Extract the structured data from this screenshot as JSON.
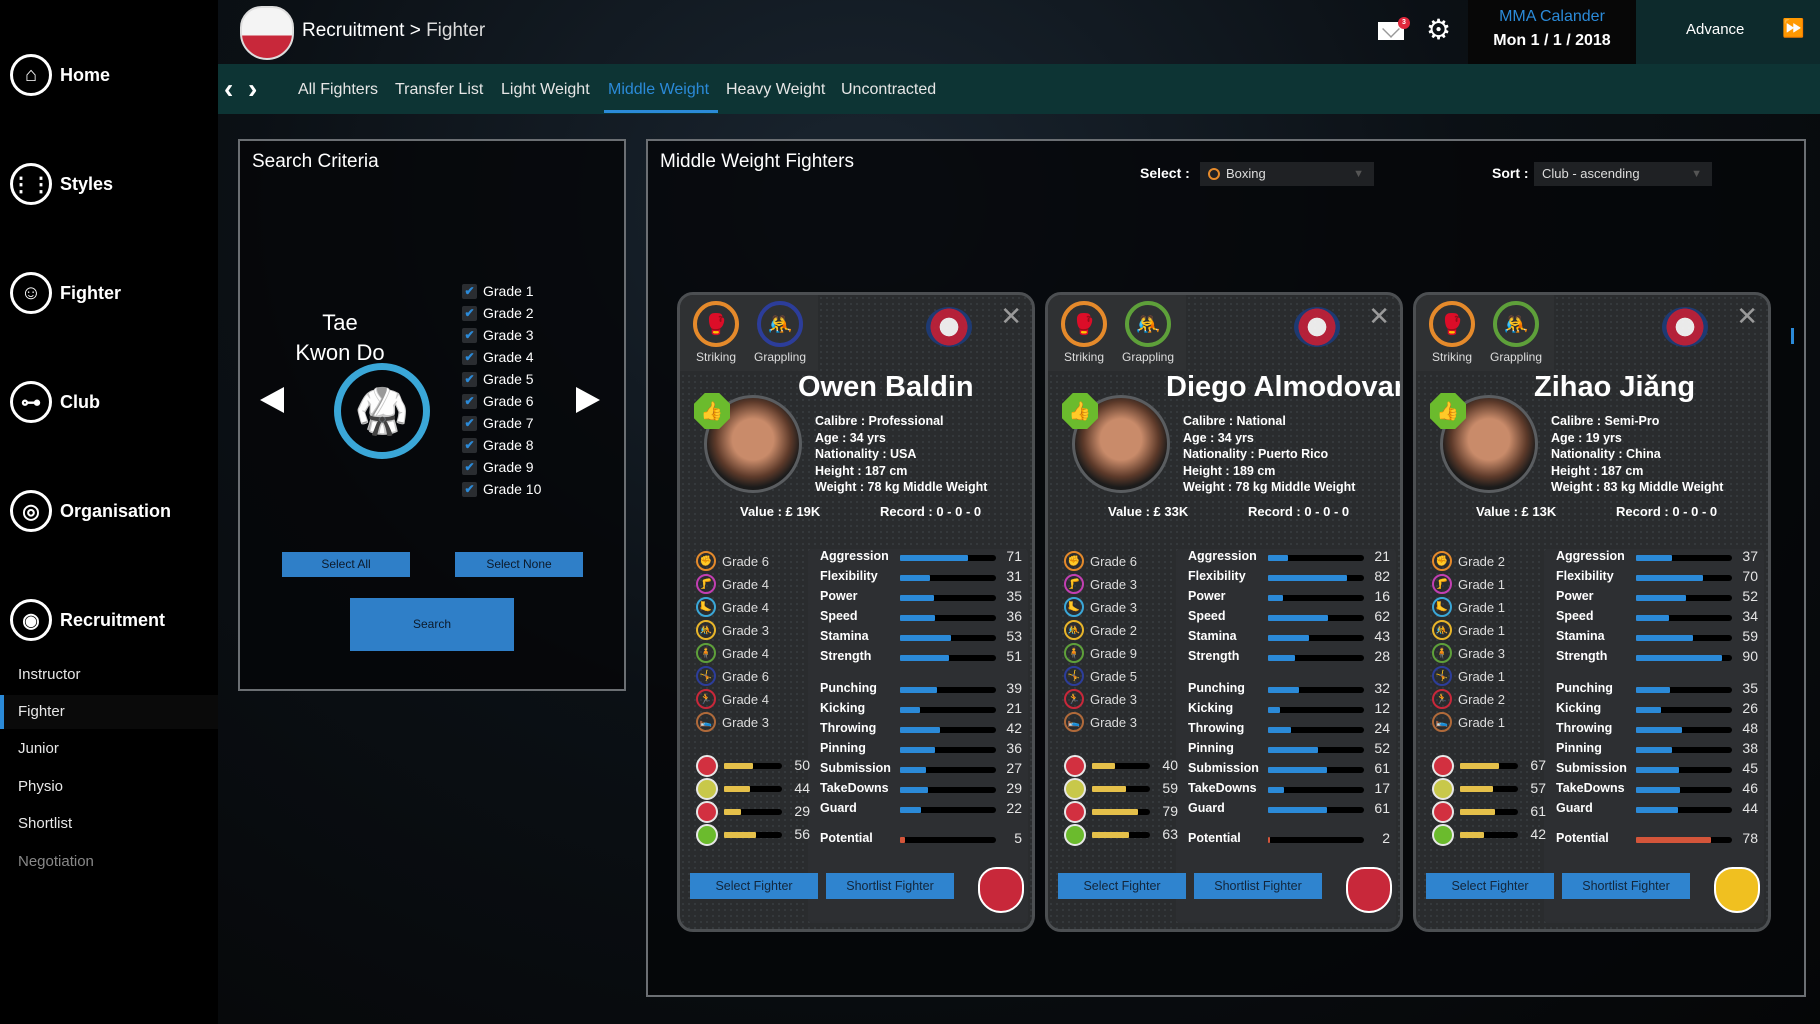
{
  "header": {
    "breadcrumb_parent": "Recruitment",
    "breadcrumb_sep": " > ",
    "breadcrumb_current": "Fighter",
    "mail_badge": "3",
    "calendar_title": "MMA Calander",
    "calendar_date": "Mon 1 / 1 / 2018",
    "advance_label": "Advance",
    "advance_icon": "⏩"
  },
  "sidebar": {
    "items": [
      {
        "label": "Home",
        "icon": "⌂"
      },
      {
        "label": "Styles",
        "icon": "⋮⋮"
      },
      {
        "label": "Fighter",
        "icon": "☺"
      },
      {
        "label": "Club",
        "icon": "⊶"
      },
      {
        "label": "Organisation",
        "icon": "◎"
      },
      {
        "label": "Recruitment",
        "icon": "◉"
      }
    ],
    "sub_items": [
      {
        "label": "Instructor"
      },
      {
        "label": "Fighter"
      },
      {
        "label": "Junior"
      },
      {
        "label": "Physio"
      },
      {
        "label": "Shortlist"
      },
      {
        "label": "Negotiation"
      }
    ]
  },
  "tabs": {
    "prev": "‹",
    "next": "›",
    "items": [
      "All Fighters",
      "Transfer List",
      "Light Weight",
      "Middle Weight",
      "Heavy Weight",
      "Uncontracted"
    ],
    "active": "Middle Weight"
  },
  "search": {
    "title": "Search Criteria",
    "style_line1": "Tae",
    "style_line2": "Kwon Do",
    "grades": [
      "Grade 1",
      "Grade 2",
      "Grade 3",
      "Grade 4",
      "Grade 5",
      "Grade 6",
      "Grade 7",
      "Grade 8",
      "Grade 9",
      "Grade 10"
    ],
    "check": "✔",
    "select_all": "Select All",
    "select_none": "Select None",
    "search": "Search"
  },
  "list": {
    "title": "Middle Weight Fighters",
    "select_label": "Select :",
    "select_value": "Boxing",
    "sort_label": "Sort :",
    "sort_value": "Club - ascending",
    "caret": "▼"
  },
  "card_labels": {
    "striking": "Striking",
    "grappling": "Grappling",
    "close": "✕",
    "select_btn": "Select Fighter",
    "shortlist_btn": "Shortlist Fighter",
    "attr_names": [
      "Aggression",
      "Flexibility",
      "Power",
      "Speed",
      "Stamina",
      "Strength",
      "Punching",
      "Kicking",
      "Throwing",
      "Pinning",
      "Submission",
      "TakeDowns",
      "Guard"
    ],
    "potential": "Potential"
  },
  "fighters": [
    {
      "name": "Owen Baldin",
      "calibre": "Calibre :  Professional",
      "age": "Age :  34 yrs",
      "nationality": "Nationality :  USA",
      "height": "Height :  187 cm",
      "weight": "Weight :  78 kg  Middle Weight",
      "value": "Value :  £ 19K",
      "record": "Record :  0 - 0 - 0",
      "grappling_color": "#2c3d9a",
      "grades": [
        "Grade 6",
        "Grade 4",
        "Grade 4",
        "Grade 3",
        "Grade 4",
        "Grade 6",
        "Grade 4",
        "Grade 3"
      ],
      "attrs": [
        71,
        31,
        35,
        36,
        53,
        51,
        39,
        21,
        42,
        36,
        27,
        29,
        22
      ],
      "vitals": [
        50,
        44,
        29,
        56
      ],
      "potential": 5,
      "club_color": "#c8283a"
    },
    {
      "name": "Diego Almodovar",
      "calibre": "Calibre :  National",
      "age": "Age :  34 yrs",
      "nationality": "Nationality :  Puerto Rico",
      "height": "Height :  189 cm",
      "weight": "Weight :  78 kg  Middle Weight",
      "value": "Value :  £ 33K",
      "record": "Record :  0 - 0 - 0",
      "grappling_color": "#5ea03a",
      "grades": [
        "Grade 6",
        "Grade 3",
        "Grade 3",
        "Grade 2",
        "Grade 9",
        "Grade 5",
        "Grade 3",
        "Grade 3"
      ],
      "attrs": [
        21,
        82,
        16,
        62,
        43,
        28,
        32,
        12,
        24,
        52,
        61,
        17,
        61
      ],
      "vitals": [
        40,
        59,
        79,
        63
      ],
      "potential": 2,
      "club_color": "#c8283a"
    },
    {
      "name": "Zihao Jiǎng",
      "calibre": "Calibre :  Semi-Pro",
      "age": "Age :  19 yrs",
      "nationality": "Nationality :  China",
      "height": "Height :  187 cm",
      "weight": "Weight :  83 kg  Middle Weight",
      "value": "Value :  £ 13K",
      "record": "Record :  0 - 0 - 0",
      "grappling_color": "#5ea03a",
      "grades": [
        "Grade 2",
        "Grade 1",
        "Grade 1",
        "Grade 1",
        "Grade 3",
        "Grade 1",
        "Grade 2",
        "Grade 1"
      ],
      "attrs": [
        37,
        70,
        52,
        34,
        59,
        90,
        35,
        26,
        48,
        38,
        45,
        46,
        44
      ],
      "vitals": [
        67,
        57,
        61,
        42
      ],
      "potential": 78,
      "club_color": "#f0c020"
    }
  ],
  "grade_icon_colors": [
    "#e58a2b",
    "#c23fb2",
    "#3aa7d8",
    "#e8b52a",
    "#5ea03a",
    "#2c3d9a",
    "#c8283a",
    "#b06a3a"
  ]
}
